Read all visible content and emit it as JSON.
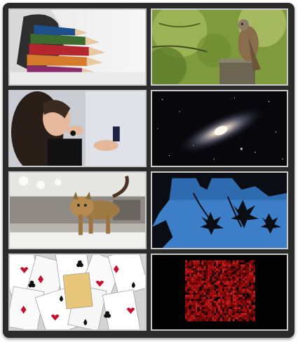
{
  "gallery": {
    "tiles": [
      {
        "subject": "colored-pencils"
      },
      {
        "subject": "kestrel-on-stump"
      },
      {
        "subject": "woman-with-compact-mirror"
      },
      {
        "subject": "andromeda-galaxy"
      },
      {
        "subject": "walking-bengal-cat"
      },
      {
        "subject": "maple-leaves-silhouette"
      },
      {
        "subject": "playing-cards"
      },
      {
        "subject": "red-pixel-pattern"
      }
    ]
  }
}
